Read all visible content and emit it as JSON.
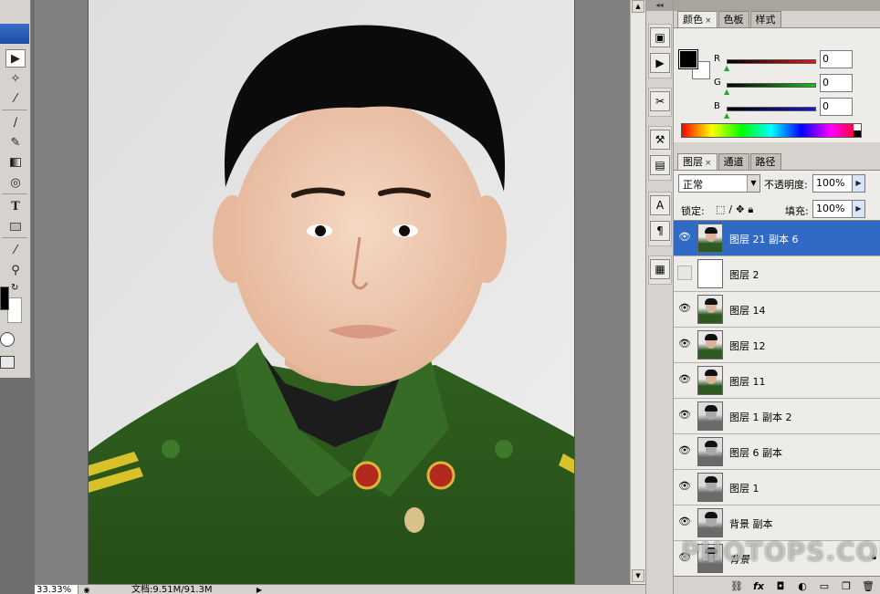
{
  "toolbox": {
    "tools": [
      {
        "icon": "move-icon",
        "glyph": "▶✚"
      },
      {
        "icon": "magic-wand-icon",
        "glyph": "✧"
      },
      {
        "icon": "eyedropper-slice-icon",
        "glyph": "⁄"
      },
      {
        "icon": "brush-icon",
        "glyph": "∕"
      },
      {
        "icon": "history-brush-icon",
        "glyph": "✎"
      },
      {
        "icon": "gradient-icon",
        "glyph": "▬"
      },
      {
        "icon": "blur-icon",
        "glyph": "◎"
      },
      {
        "icon": "type-icon",
        "glyph": "T"
      },
      {
        "icon": "shape-icon",
        "glyph": "▭"
      },
      {
        "icon": "eyedropper-icon",
        "glyph": "⁄"
      },
      {
        "icon": "zoom-icon",
        "glyph": "⚲"
      }
    ]
  },
  "status": {
    "zoom": "33.33%",
    "doc_info": "文档:9.51M/91.3M"
  },
  "watermark": "PHOTOPS.COM",
  "color_panel": {
    "tabs": [
      {
        "label": "颜色",
        "closable": true,
        "active": true
      },
      {
        "label": "色板",
        "closable": false,
        "active": false
      },
      {
        "label": "样式",
        "closable": false,
        "active": false
      }
    ],
    "channels": [
      {
        "label": "R",
        "value": "0",
        "color": "#c0141e"
      },
      {
        "label": "G",
        "value": "0",
        "color": "#1aa01a"
      },
      {
        "label": "B",
        "value": "0",
        "color": "#1a1aa8"
      }
    ]
  },
  "layers_panel": {
    "tabs": [
      {
        "label": "图层",
        "closable": true,
        "active": true
      },
      {
        "label": "通道",
        "closable": false,
        "active": false
      },
      {
        "label": "路径",
        "closable": false,
        "active": false
      }
    ],
    "blend_mode": "正常",
    "opacity_label": "不透明度:",
    "opacity_value": "100%",
    "lock_label": "锁定:",
    "fill_label": "填充:",
    "fill_value": "100%",
    "layers": [
      {
        "name": "图层 21 副本 6",
        "visible": true,
        "selected": true,
        "thumb": "color"
      },
      {
        "name": "图层 2",
        "visible": false,
        "selected": false,
        "thumb": "white"
      },
      {
        "name": "图层 14",
        "visible": true,
        "selected": false,
        "thumb": "color"
      },
      {
        "name": "图层 12",
        "visible": true,
        "selected": false,
        "thumb": "color"
      },
      {
        "name": "图层 11",
        "visible": true,
        "selected": false,
        "thumb": "color"
      },
      {
        "name": "图层 1 副本 2",
        "visible": true,
        "selected": false,
        "thumb": "gray"
      },
      {
        "name": "图层 6 副本",
        "visible": true,
        "selected": false,
        "thumb": "gray"
      },
      {
        "name": "图层 1",
        "visible": true,
        "selected": false,
        "thumb": "gray"
      },
      {
        "name": "背景 副本",
        "visible": true,
        "selected": false,
        "thumb": "gray"
      },
      {
        "name": "背景",
        "visible": true,
        "selected": false,
        "thumb": "gray",
        "locked": true
      }
    ],
    "footer_icons": [
      "link-layers-icon",
      "fx-icon",
      "add-mask-icon",
      "adjustment-layer-icon",
      "new-group-icon",
      "new-layer-icon",
      "delete-layer-icon"
    ]
  }
}
